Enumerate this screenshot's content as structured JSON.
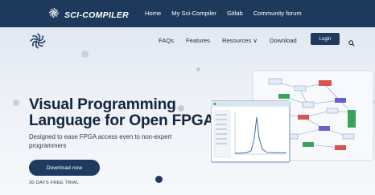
{
  "topbar": {
    "brand": "SCI-COMPILER",
    "links": [
      "Home",
      "My Sci-Compiler",
      "Gitlab",
      "Community forum"
    ]
  },
  "mainnav": {
    "links": [
      "FAQs",
      "Features",
      "Resources ∨",
      "Download"
    ],
    "login_label": "Login"
  },
  "hero": {
    "title_line1": "Visual Programming",
    "title_line2": "Language for Open FPGA",
    "subtitle": "Designed to ease FPGA access even to non-expert programmers",
    "cta_label": "Download now",
    "trial_note": "30 DAYS FREE TRIAL"
  },
  "colors": {
    "topbar": "#1d3a5c",
    "primary_button": "#1e3a5f",
    "heading": "#13263f",
    "accent_red": "#d9534f",
    "accent_purple": "#6f5bd6",
    "accent_green": "#3aa35b"
  },
  "icons": [
    "sci-compiler-logo-icon",
    "search-icon"
  ]
}
